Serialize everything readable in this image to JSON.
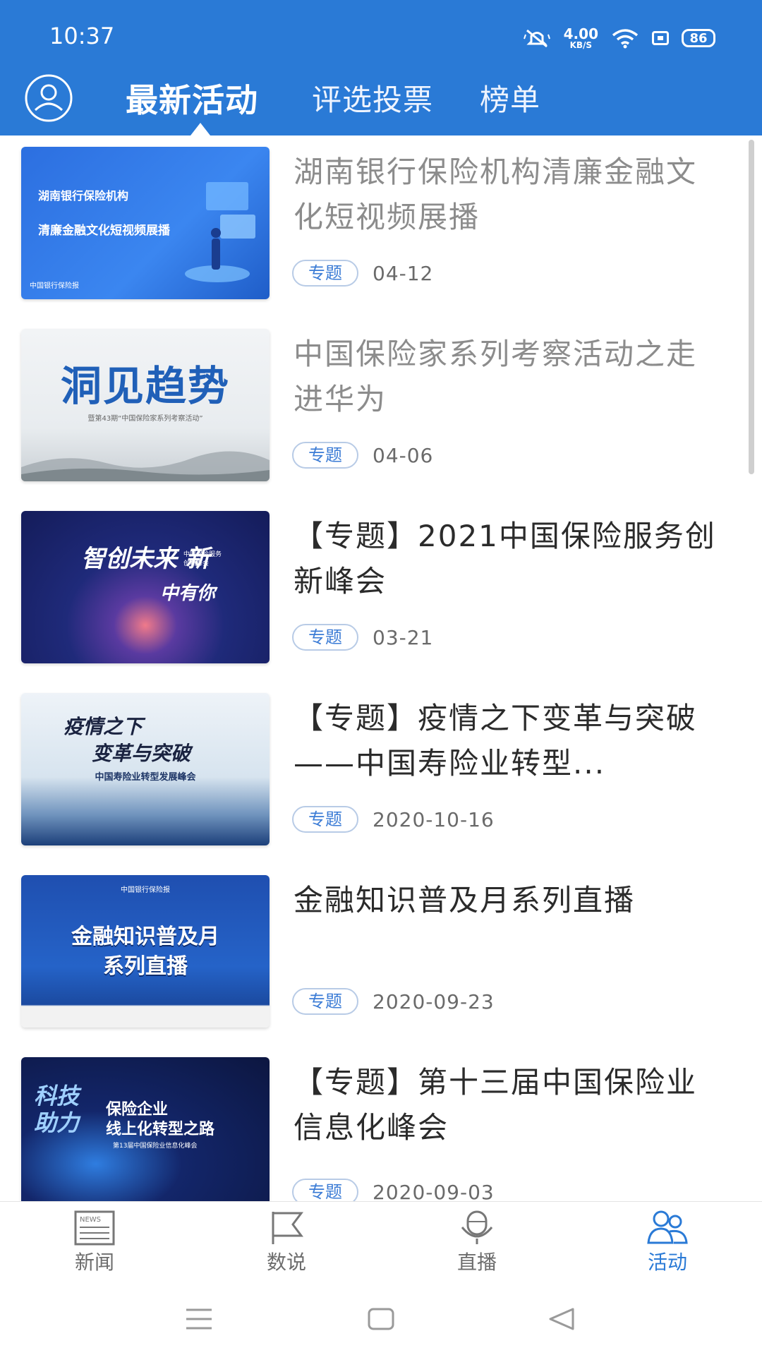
{
  "status_bar": {
    "time": "10:37",
    "speed_value": "4.00",
    "speed_unit": "KB/S",
    "battery": "86"
  },
  "header": {
    "tabs": [
      {
        "label": "最新活动",
        "active": true
      },
      {
        "label": "评选投票",
        "active": false
      },
      {
        "label": "榜单",
        "active": false
      }
    ]
  },
  "items": [
    {
      "title": "湖南银行保险机构清廉金融文化短视频展播",
      "tag": "专题",
      "date": "04-12",
      "read": true,
      "thumb": {
        "line1": "湖南银行保险机构",
        "line2": "清廉金融文化短视频展播",
        "footer": "中国银行保险报"
      }
    },
    {
      "title": "中国保险家系列考察活动之走进华为",
      "tag": "专题",
      "date": "04-06",
      "read": true,
      "thumb": {
        "line1": "洞见趋势",
        "line2": "暨第43期“中国保险家系列考察活动”"
      }
    },
    {
      "title": "【专题】2021中国保险服务创新峰会",
      "tag": "专题",
      "date": "03-21",
      "read": false,
      "thumb": {
        "line1": "智创未来 新",
        "line2": "中有你",
        "side": "中国保险服务创新峰会"
      }
    },
    {
      "title": "【专题】疫情之下变革与突破——中国寿险业转型...",
      "tag": "专题",
      "date": "2020-10-16",
      "read": false,
      "thumb": {
        "line1": "疫情之下",
        "line2": "变革与突破",
        "line3": "中国寿险业转型发展峰会"
      }
    },
    {
      "title": "金融知识普及月系列直播",
      "tag": "专题",
      "date": "2020-09-23",
      "read": false,
      "thumb": {
        "top": "中国银行保险报",
        "line1": "金融知识普及月",
        "line2": "系列直播"
      }
    },
    {
      "title": "【专题】第十三届中国保险业信息化峰会",
      "tag": "专题",
      "date": "2020-09-03",
      "read": false,
      "thumb": {
        "line1": "科技助力",
        "line2": "保险企业",
        "line3": "线上化转型之路",
        "line4": "第13届中国保险业信息化峰会"
      }
    }
  ],
  "bottom_nav": [
    {
      "label": "新闻",
      "icon": "newspaper-icon",
      "active": false,
      "badge": "NEWS"
    },
    {
      "label": "数说",
      "icon": "flag-icon",
      "active": false
    },
    {
      "label": "直播",
      "icon": "microphone-icon",
      "active": false
    },
    {
      "label": "活动",
      "icon": "people-icon",
      "active": true
    }
  ],
  "colors": {
    "header_bg": "#2a7ad6",
    "accent": "#2a7ad6",
    "tag_text": "#3a7bd5"
  }
}
